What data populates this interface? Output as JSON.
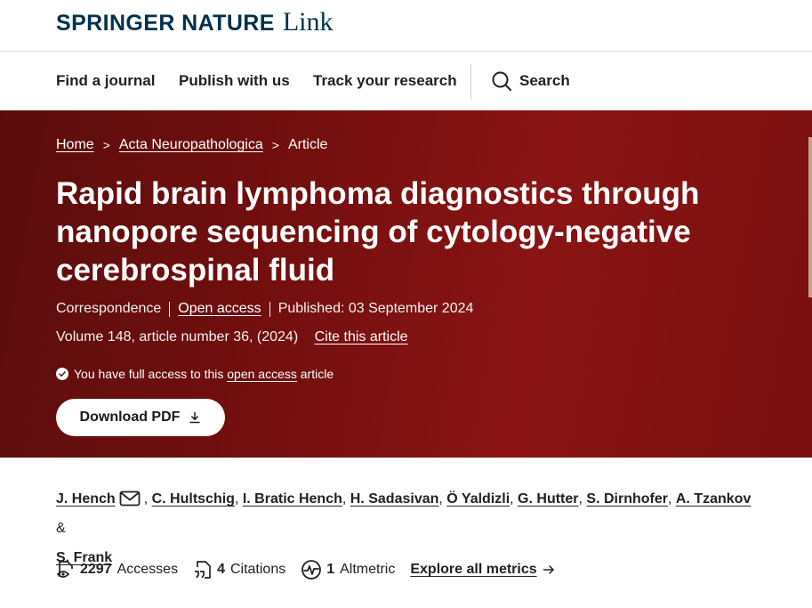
{
  "brand": {
    "name": "SPRINGER NATURE",
    "suffix": "Link"
  },
  "nav": {
    "find_journal": "Find a journal",
    "publish": "Publish with us",
    "track": "Track your research",
    "search": "Search"
  },
  "breadcrumb": {
    "home": "Home",
    "journal": "Acta Neuropathologica",
    "current": "Article",
    "separator": ">"
  },
  "article": {
    "title": "Rapid brain lymphoma diagnostics through nanopore sequencing of cytology-negative cerebrospinal fluid",
    "type": "Correspondence",
    "access": "Open access",
    "published": "Published: 03 September 2024",
    "volume": "Volume 148, article number 36, (2024)",
    "cite": "Cite this article",
    "access_note_prefix": "You have full access to this",
    "access_note_link": "open access",
    "access_note_suffix": "article",
    "download": "Download PDF"
  },
  "authors": {
    "list": [
      "J. Hench",
      "C. Hultschig",
      "I. Bratic Hench",
      "H. Sadasivan",
      "Ö Yaldizli",
      "G. Hutter",
      "S. Dirnhofer",
      "A. Tzankov",
      "S. Frank"
    ],
    "comma": ",",
    "and": "&"
  },
  "metrics": {
    "accesses_value": "2297",
    "accesses_label": "Accesses",
    "citations_value": "4",
    "citations_label": "Citations",
    "altmetric_value": "1",
    "altmetric_label": "Altmetric",
    "explore": "Explore all metrics"
  },
  "colors": {
    "brand": "#01324b",
    "hero": "#7a1010"
  }
}
